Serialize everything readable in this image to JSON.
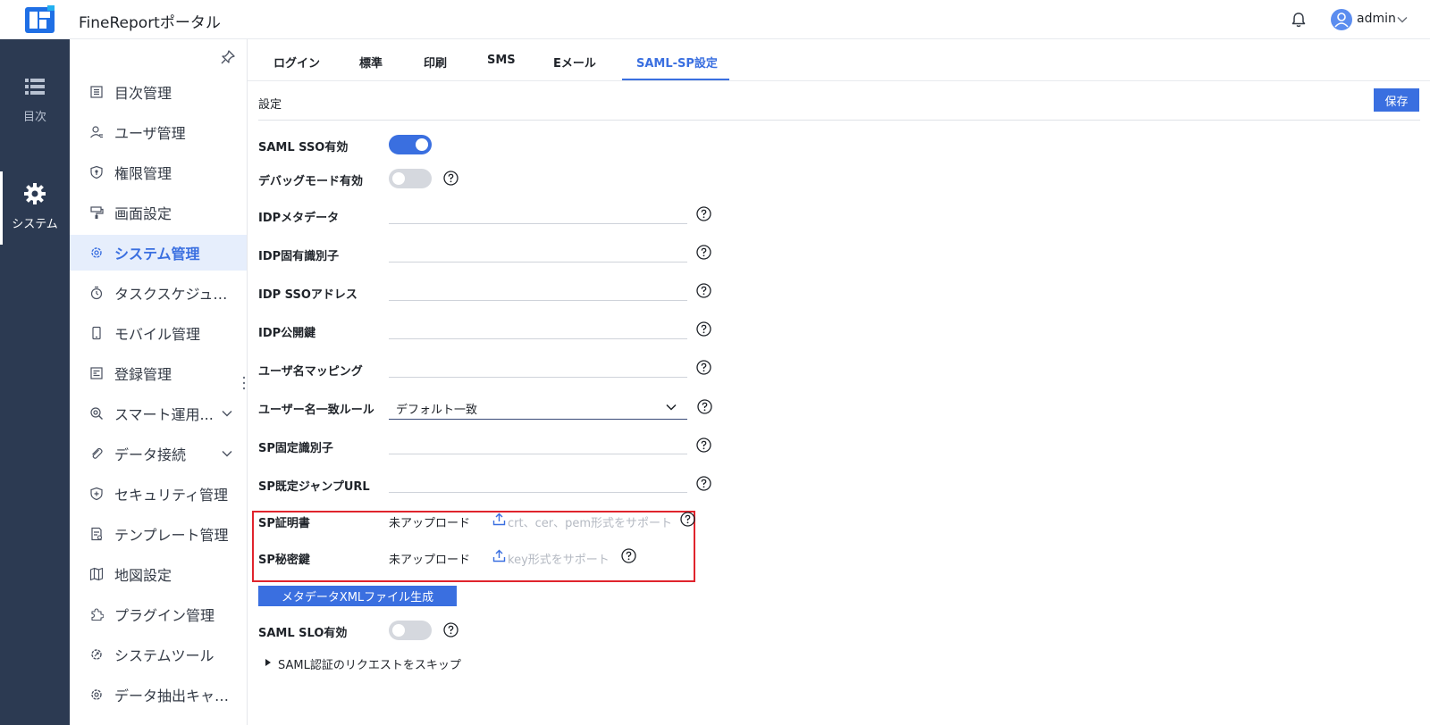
{
  "header": {
    "title": "FineReportポータル",
    "user_name": "admin"
  },
  "nav_dark": [
    {
      "label": "目次",
      "icon": "list-icon"
    },
    {
      "label": "システム",
      "icon": "gear-icon",
      "active": true
    }
  ],
  "submenu": {
    "items": [
      {
        "label": "目次管理",
        "icon": "catalog-icon"
      },
      {
        "label": "ユーザ管理",
        "icon": "user-icon"
      },
      {
        "label": "権限管理",
        "icon": "permission-icon"
      },
      {
        "label": "画面設定",
        "icon": "brush-icon"
      },
      {
        "label": "システム管理",
        "icon": "gear-icon",
        "active": true
      },
      {
        "label": "タスクスケジューラ",
        "icon": "timer-icon"
      },
      {
        "label": "モバイル管理",
        "icon": "mobile-icon"
      },
      {
        "label": "登録管理",
        "icon": "register-icon"
      },
      {
        "label": "スマート運用...",
        "icon": "smart-ops-icon",
        "expandable": true
      },
      {
        "label": "データ接続",
        "icon": "paperclip-icon",
        "expandable": true
      },
      {
        "label": "セキュリティ管理",
        "icon": "shield-icon"
      },
      {
        "label": "テンプレート管理",
        "icon": "template-icon"
      },
      {
        "label": "地図設定",
        "icon": "map-icon"
      },
      {
        "label": "プラグイン管理",
        "icon": "plugin-icon"
      },
      {
        "label": "システムツール",
        "icon": "tool-icon"
      },
      {
        "label": "データ抽出キャッ...",
        "icon": "extract-icon"
      }
    ]
  },
  "tabs": [
    "ログイン",
    "標準",
    "印刷",
    "SMS",
    "Eメール",
    "SAML-SP設定"
  ],
  "active_tab": "SAML-SP設定",
  "section": {
    "title": "設定",
    "save_label": "保存"
  },
  "fields": {
    "saml_sso": {
      "label": "SAML SSO有効",
      "enabled": true
    },
    "debug_mode": {
      "label": "デバッグモード有効",
      "enabled": false
    },
    "idp_metadata": {
      "label": "IDPメタデータ",
      "value": ""
    },
    "idp_entity_id": {
      "label": "IDP固有識別子",
      "value": ""
    },
    "idp_sso_address": {
      "label": "IDP SSOアドレス",
      "value": ""
    },
    "idp_public_key": {
      "label": "IDP公開鍵",
      "value": ""
    },
    "username_mapping": {
      "label": "ユーザ名マッピング",
      "value": ""
    },
    "username_match_rule": {
      "label": "ユーザー名一致ルール",
      "value": "デフォルト一致"
    },
    "sp_entity_id": {
      "label": "SP固定識別子",
      "value": ""
    },
    "sp_default_jump_url": {
      "label": "SP既定ジャンプURL",
      "value": ""
    },
    "sp_certificate": {
      "label": "SP証明書",
      "status": "未アップロード",
      "hint": "crt、cer、pem形式をサポート"
    },
    "sp_private_key": {
      "label": "SP秘密鍵",
      "status": "未アップロード",
      "hint": "key形式をサポート"
    },
    "generate_metadata_label": "メタデータXMLファイル生成",
    "saml_slo": {
      "label": "SAML SLO有効",
      "enabled": false
    },
    "skip_auth_request_label": "SAML認証のリクエストをスキップ"
  },
  "colors": {
    "primary": "#3a6fe0",
    "nav_bg": "#2c3a52",
    "highlight": "#e0242d"
  }
}
